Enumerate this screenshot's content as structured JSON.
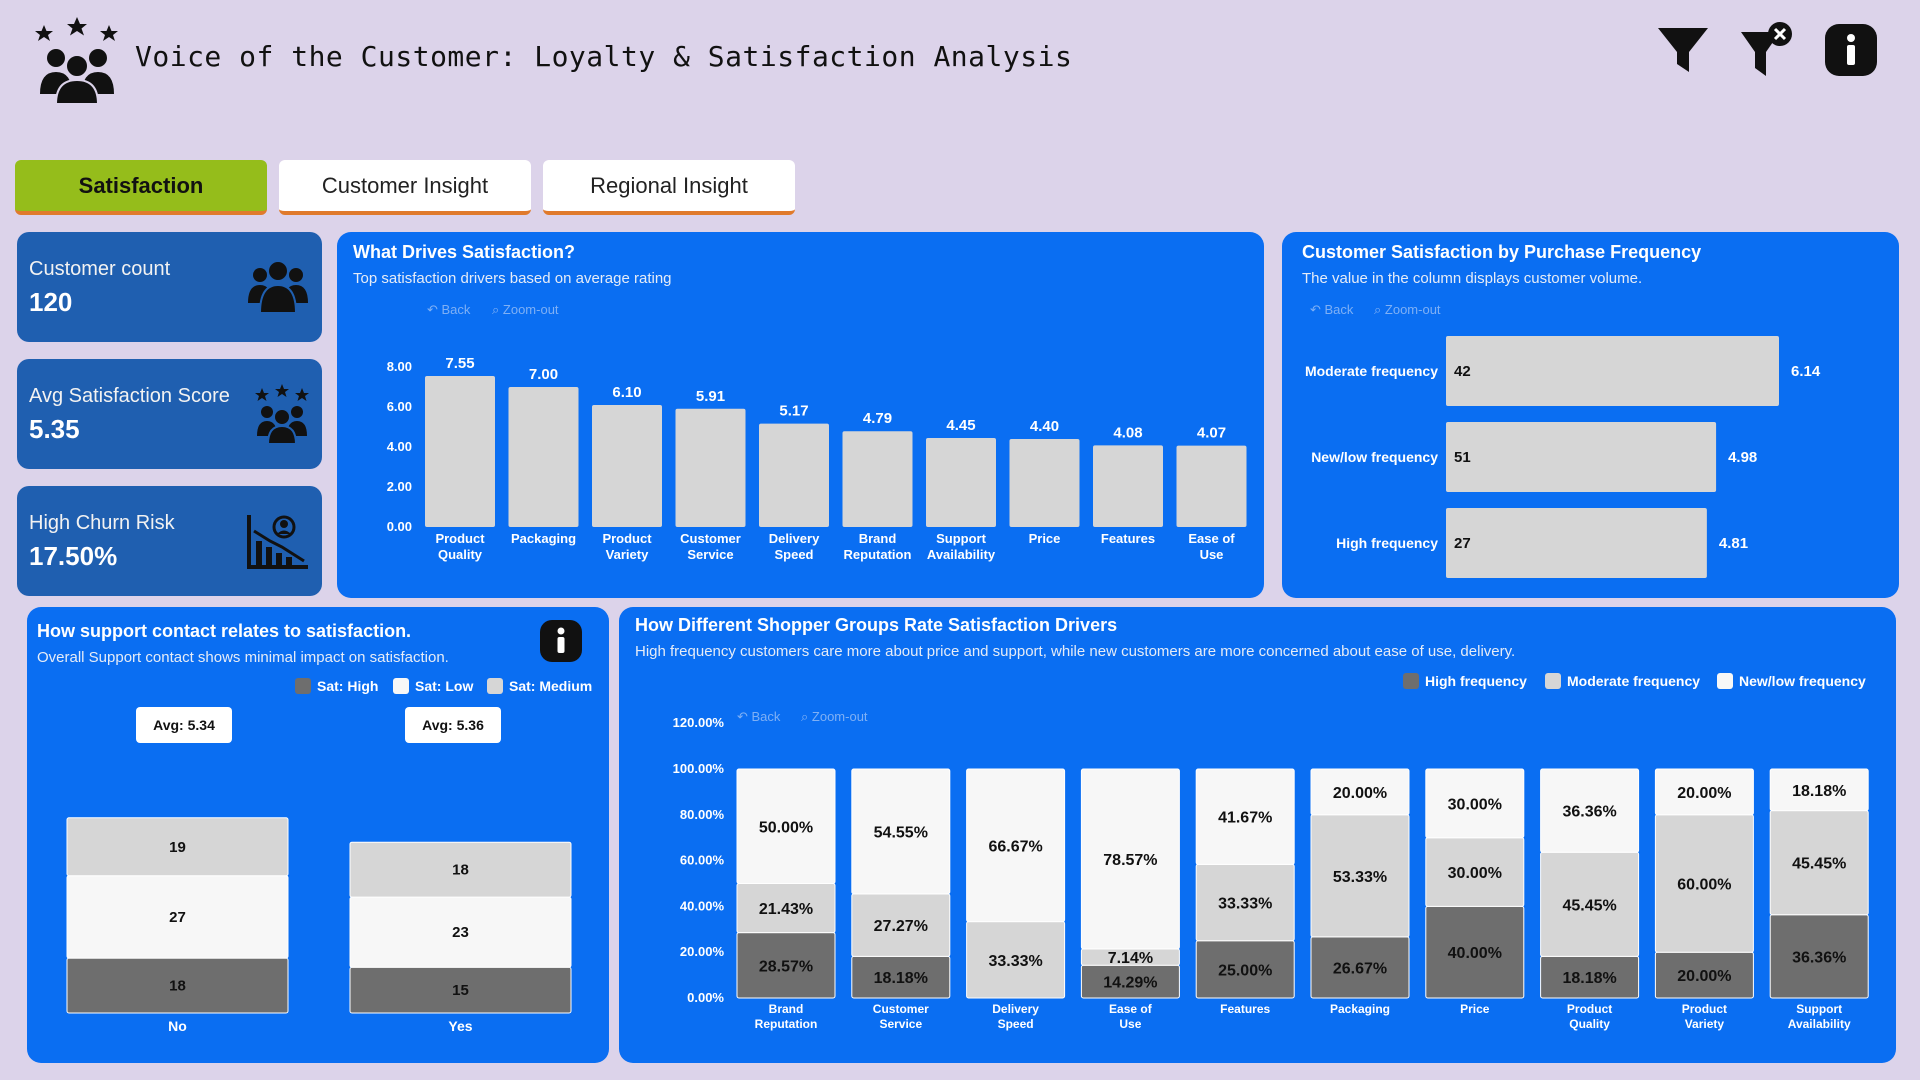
{
  "header": {
    "title": "Voice of the Customer: Loyalty & Satisfaction Analysis",
    "logo_icon": "customer-group-stars-icon",
    "actions": [
      {
        "name": "filter-icon"
      },
      {
        "name": "clear-filter-icon"
      },
      {
        "name": "info-icon"
      }
    ]
  },
  "tabs": [
    {
      "label": "Satisfaction",
      "active": true
    },
    {
      "label": "Customer Insight",
      "active": false
    },
    {
      "label": "Regional Insight",
      "active": false
    }
  ],
  "kpis": [
    {
      "label": "Customer count",
      "value": "120",
      "icon": "people-group-icon"
    },
    {
      "label": "Avg Satisfaction Score",
      "value": "5.35",
      "icon": "people-stars-icon"
    },
    {
      "label": "High Churn Risk",
      "value": "17.50%",
      "icon": "chart-person-icon"
    }
  ],
  "toolbar": {
    "back": "Back",
    "zoom_out": "Zoom-out"
  },
  "colors": {
    "high": "#6e6e6e",
    "moderate": "#d6d6d6",
    "newlow": "#f7f7f7",
    "panel": "#0a6ef2",
    "kpi": "#1f5fb0"
  },
  "drivers_panel": {
    "title": "What Drives Satisfaction?",
    "subtitle": "Top satisfaction drivers based on average rating"
  },
  "frequency_panel": {
    "title": "Customer Satisfaction by Purchase Frequency",
    "subtitle": "The value in the column displays customer volume."
  },
  "support_panel": {
    "title": "How support contact relates to satisfaction.",
    "subtitle": "Overall Support contact shows minimal impact on satisfaction.",
    "legend": [
      "Sat: High",
      "Sat: Low",
      "Sat: Medium"
    ],
    "avg_labels": [
      "Avg: 5.34",
      "Avg: 5.36"
    ]
  },
  "groups_panel": {
    "title": "How Different Shopper Groups Rate Satisfaction Drivers",
    "subtitle": "High frequency customers care more about price and support, while new customers are more concerned about ease of use, delivery.",
    "legend": [
      "High frequency",
      "Moderate frequency",
      "New/low frequency"
    ]
  },
  "chart_data": [
    {
      "type": "bar",
      "title": "What Drives Satisfaction?",
      "categories": [
        "Product Quality",
        "Packaging",
        "Product Variety",
        "Customer Service",
        "Delivery Speed",
        "Brand Reputation",
        "Support Availability",
        "Price",
        "Features",
        "Ease of Use"
      ],
      "values": [
        7.55,
        7.0,
        6.1,
        5.91,
        5.17,
        4.79,
        4.45,
        4.4,
        4.08,
        4.07
      ],
      "value_labels": [
        "7.55",
        "7.00",
        "6.10",
        "5.91",
        "5.17",
        "4.79",
        "4.45",
        "4.40",
        "4.08",
        "4.07"
      ],
      "yticks": [
        "0.00",
        "2.00",
        "4.00",
        "6.00",
        "8.00"
      ],
      "ylim": [
        0,
        8
      ]
    },
    {
      "type": "bar",
      "orientation": "horizontal",
      "title": "Customer Satisfaction by Purchase Frequency",
      "categories": [
        "Moderate frequency",
        "New/low frequency",
        "High frequency"
      ],
      "values": [
        6.14,
        4.98,
        4.81
      ],
      "value_labels": [
        "6.14",
        "4.98",
        "4.81"
      ],
      "customer_counts": [
        "42",
        "51",
        "27"
      ]
    },
    {
      "type": "bar",
      "stacked": true,
      "title": "How support contact relates to satisfaction.",
      "categories": [
        "No",
        "Yes"
      ],
      "series": [
        {
          "name": "Sat: High",
          "values": [
            18,
            15
          ]
        },
        {
          "name": "Sat: Low",
          "values": [
            27,
            23
          ]
        },
        {
          "name": "Sat: Medium",
          "values": [
            19,
            18
          ]
        }
      ]
    },
    {
      "type": "bar",
      "stacked": true,
      "title": "How Different Shopper Groups Rate Satisfaction Drivers",
      "categories": [
        "Brand Reputation",
        "Customer Service",
        "Delivery Speed",
        "Ease of Use",
        "Features",
        "Packaging",
        "Price",
        "Product Quality",
        "Product Variety",
        "Support Availability"
      ],
      "series": [
        {
          "name": "High frequency",
          "values": [
            28.57,
            18.18,
            0,
            14.29,
            25.0,
            26.67,
            40.0,
            18.18,
            20.0,
            36.36
          ],
          "labels": [
            "28.57%",
            "18.18%",
            "",
            "14.29%",
            "25.00%",
            "26.67%",
            "40.00%",
            "18.18%",
            "20.00%",
            "36.36%"
          ]
        },
        {
          "name": "Moderate frequency",
          "values": [
            21.43,
            27.27,
            33.33,
            7.14,
            33.33,
            53.33,
            30.0,
            45.45,
            60.0,
            45.45
          ],
          "labels": [
            "21.43%",
            "27.27%",
            "33.33%",
            "7.14%",
            "33.33%",
            "53.33%",
            "30.00%",
            "45.45%",
            "60.00%",
            "45.45%"
          ]
        },
        {
          "name": "New/low frequency",
          "values": [
            50.0,
            54.55,
            66.67,
            78.57,
            41.67,
            20.0,
            30.0,
            36.36,
            20.0,
            18.18
          ],
          "labels": [
            "50.00%",
            "54.55%",
            "66.67%",
            "78.57%",
            "41.67%",
            "20.00%",
            "30.00%",
            "36.36%",
            "20.00%",
            "18.18%"
          ]
        }
      ],
      "yticks": [
        "0.00%",
        "20.00%",
        "40.00%",
        "60.00%",
        "80.00%",
        "100.00%",
        "120.00%"
      ],
      "ylim": [
        0,
        120
      ]
    }
  ]
}
